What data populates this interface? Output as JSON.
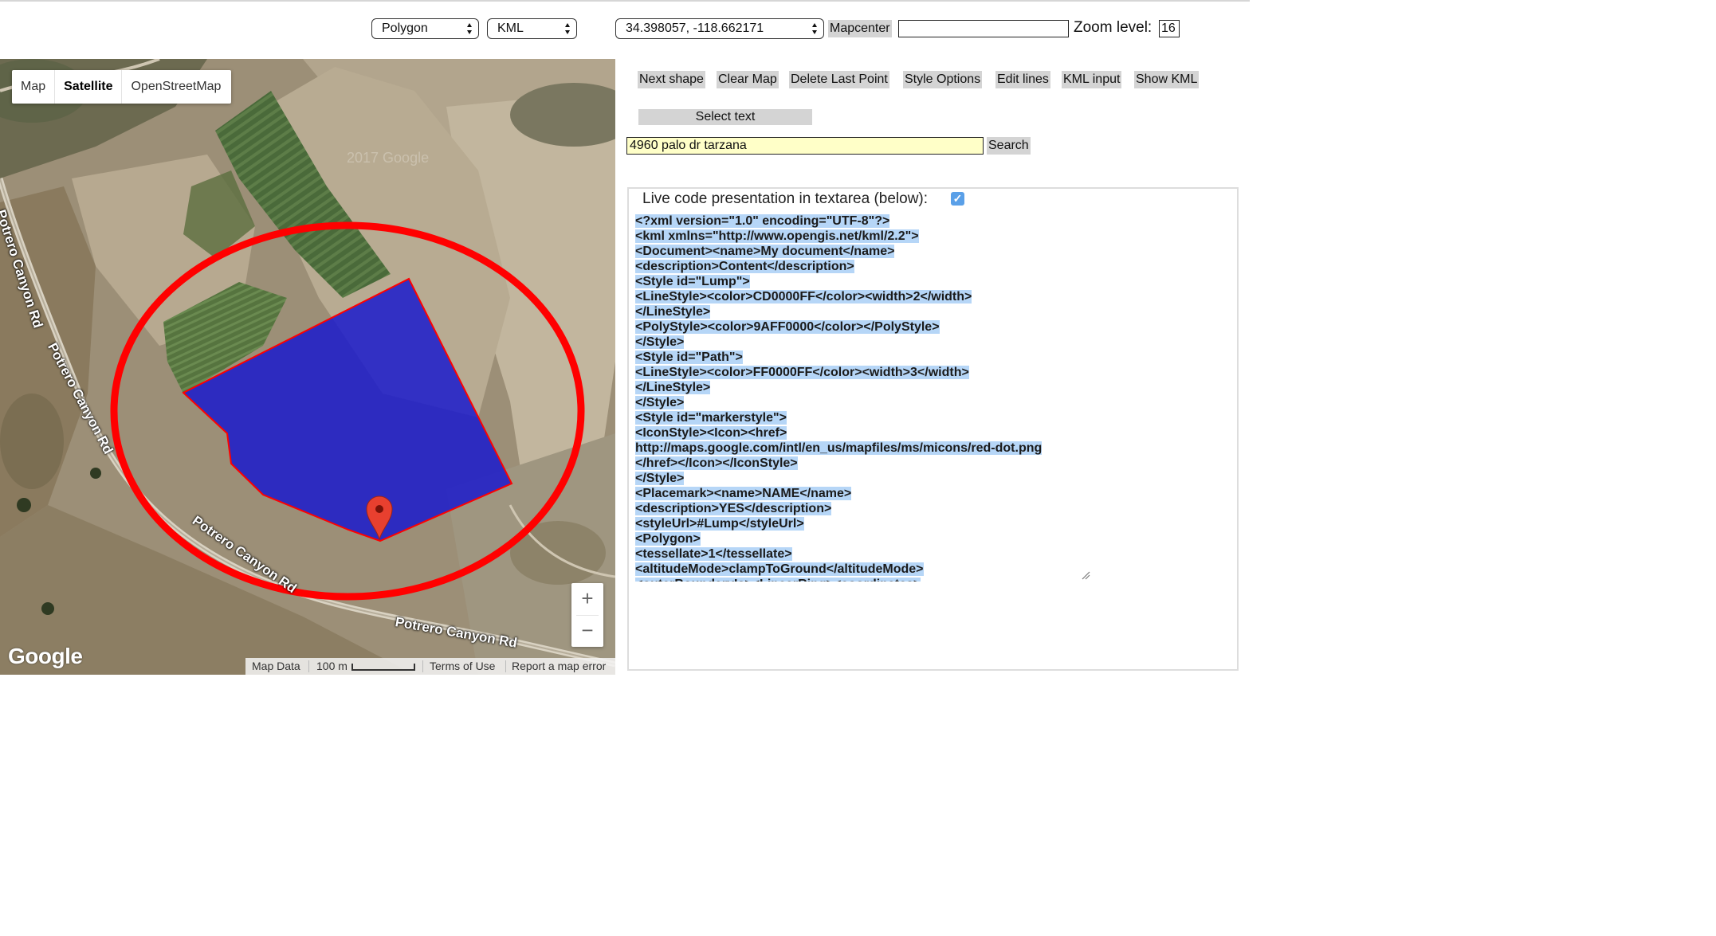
{
  "top": {
    "shape_select": "Polygon",
    "format_select": "KML",
    "coords_select": "34.398057, -118.662171",
    "mapcenter_label": "Mapcenter",
    "mapcenter_value": "",
    "zoom_label": "Zoom level:",
    "zoom_value": "16"
  },
  "map": {
    "types": [
      "Map",
      "Satellite",
      "OpenStreetMap"
    ],
    "active_type": "Satellite",
    "zoom_in": "+",
    "zoom_out": "−",
    "logo": "Google",
    "map_data": "Map Data",
    "scale": "100 m",
    "terms": "Terms of Use",
    "report": "Report a map error",
    "watermark": "2017 Google",
    "roads": [
      "Potrero Canyon Rd",
      "Potrero Canyon Rd",
      "Potrero Canyon Rd",
      "Potrero Canyon Rd"
    ],
    "colors": {
      "circle": "#ff0000",
      "polygon": "#1a1acc",
      "marker": "#e8402f"
    }
  },
  "toolbar": {
    "next_shape": "Next shape",
    "clear_map": "Clear Map",
    "delete_last": "Delete Last Point",
    "style_options": "Style Options",
    "edit_lines": "Edit lines",
    "kml_input": "KML input",
    "show_kml": "Show KML",
    "select_text": "Select text"
  },
  "search": {
    "value": "4960 palo dr tarzana",
    "button": "Search"
  },
  "live": {
    "label": "Live code presentation in textarea (below):",
    "checked": "✓",
    "code_lines": [
      "<?xml version=\"1.0\" encoding=\"UTF-8\"?>",
      "<kml xmlns=\"http://www.opengis.net/kml/2.2\">",
      "<Document><name>My document</name>",
      "<description>Content</description>",
      "<Style id=\"Lump\">",
      "<LineStyle><color>CD0000FF</color><width>2</width>",
      "</LineStyle>",
      "<PolyStyle><color>9AFF0000</color></PolyStyle>",
      "</Style>",
      "<Style id=\"Path\">",
      "<LineStyle><color>FF0000FF</color><width>3</width>",
      "</LineStyle>",
      "</Style>",
      "<Style id=\"markerstyle\">",
      "<IconStyle><Icon><href>",
      "http://maps.google.com/intl/en_us/mapfiles/ms/micons/red-dot.png",
      "</href></Icon></IconStyle>",
      "</Style>",
      "<Placemark><name>NAME</name>",
      "<description>YES</description>",
      "<styleUrl>#Lump</styleUrl>",
      "<Polygon>",
      "<tessellate>1</tessellate>",
      "<altitudeMode>clampToGround</altitudeMode>",
      "<outerBoundaryIs><LinearRing><coordinates>"
    ]
  }
}
